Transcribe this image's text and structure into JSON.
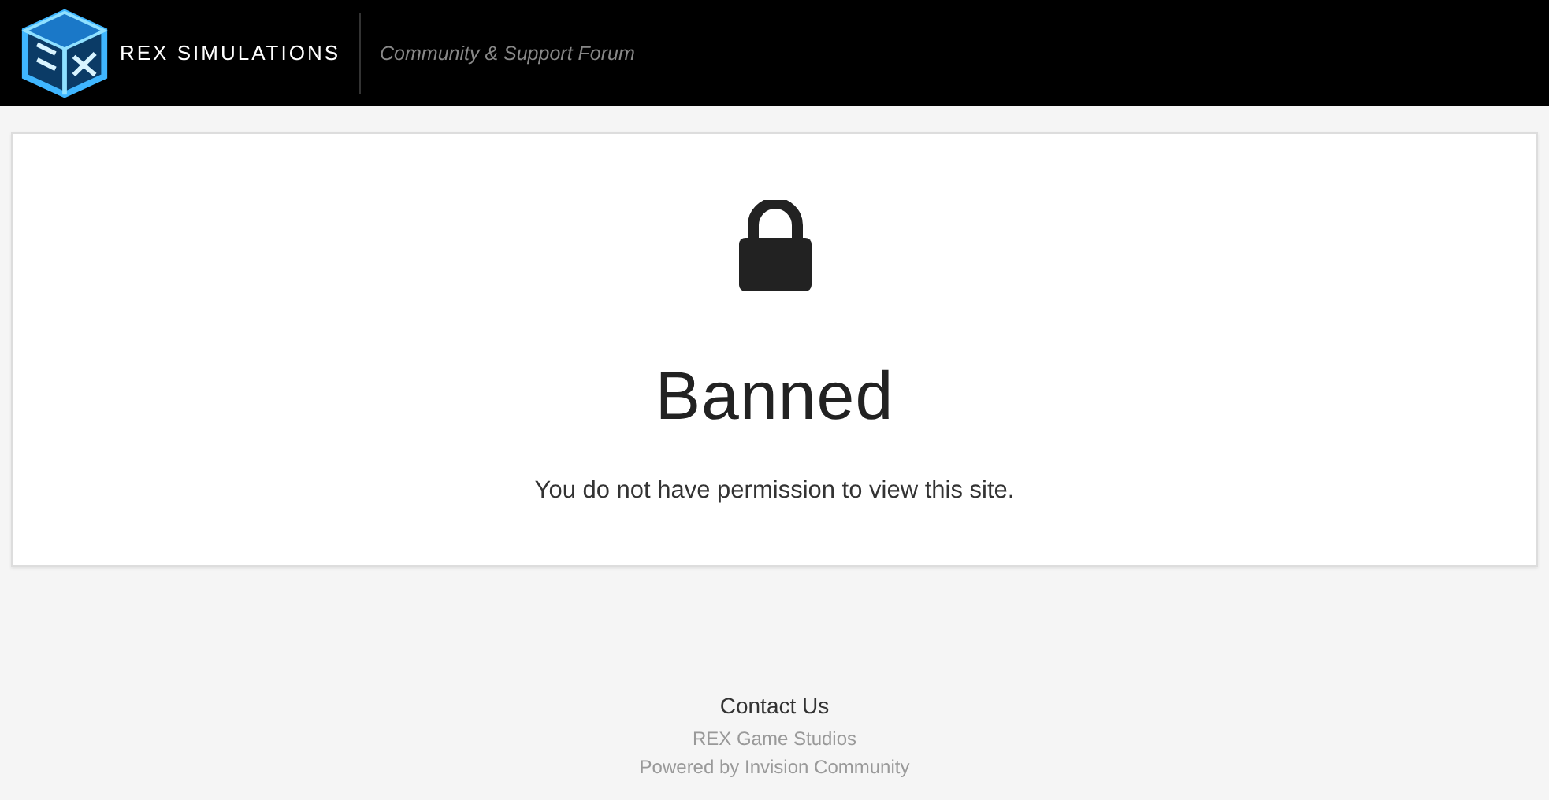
{
  "header": {
    "brand": "REX SIMULATIONS",
    "tagline": "Community & Support Forum"
  },
  "message": {
    "title": "Banned",
    "text": "You do not have permission to view this site."
  },
  "footer": {
    "link": "Contact Us",
    "copyright": "REX Game Studios",
    "powered": "Powered by Invision Community"
  }
}
